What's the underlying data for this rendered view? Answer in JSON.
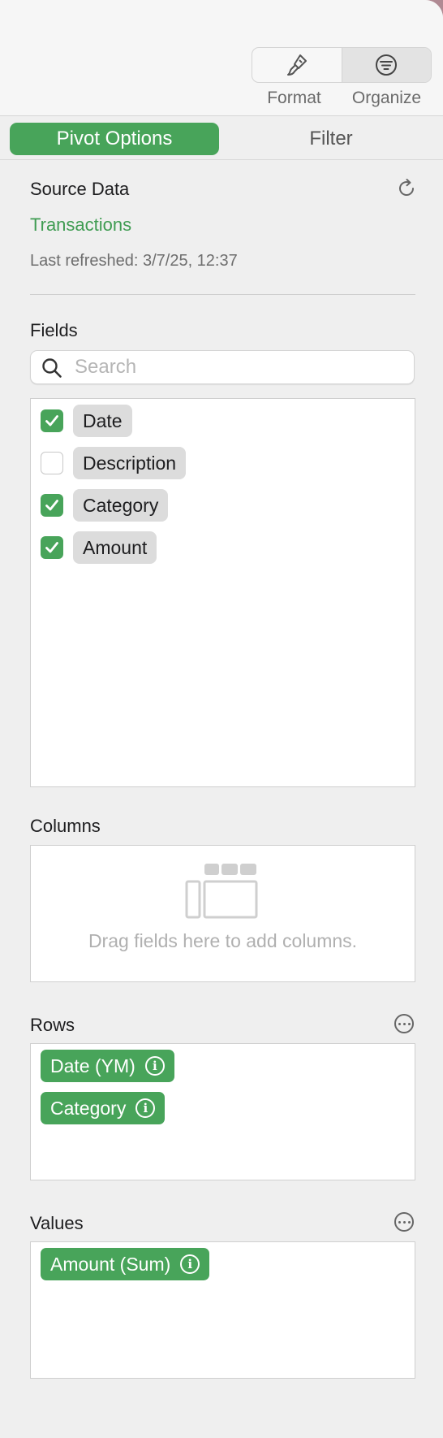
{
  "toolbar": {
    "format_label": "Format",
    "organize_label": "Organize",
    "format_icon": "paintbrush-icon",
    "organize_icon": "filter-lines-icon"
  },
  "tabs": {
    "active": "Pivot Options",
    "filter": "Filter"
  },
  "source": {
    "heading": "Source Data",
    "name": "Transactions",
    "refreshed": "Last refreshed: 3/7/25, 12:37"
  },
  "fields": {
    "heading": "Fields",
    "search_placeholder": "Search",
    "items": [
      {
        "label": "Date",
        "checked": true
      },
      {
        "label": "Description",
        "checked": false
      },
      {
        "label": "Category",
        "checked": true
      },
      {
        "label": "Amount",
        "checked": true
      }
    ]
  },
  "columns": {
    "heading": "Columns",
    "empty_hint": "Drag fields here to add columns."
  },
  "rows": {
    "heading": "Rows",
    "items": [
      "Date (YM)",
      "Category"
    ]
  },
  "values": {
    "heading": "Values",
    "items": [
      "Amount (Sum)"
    ]
  },
  "colors": {
    "accent": "#48a45a",
    "link": "#3f9c52"
  }
}
